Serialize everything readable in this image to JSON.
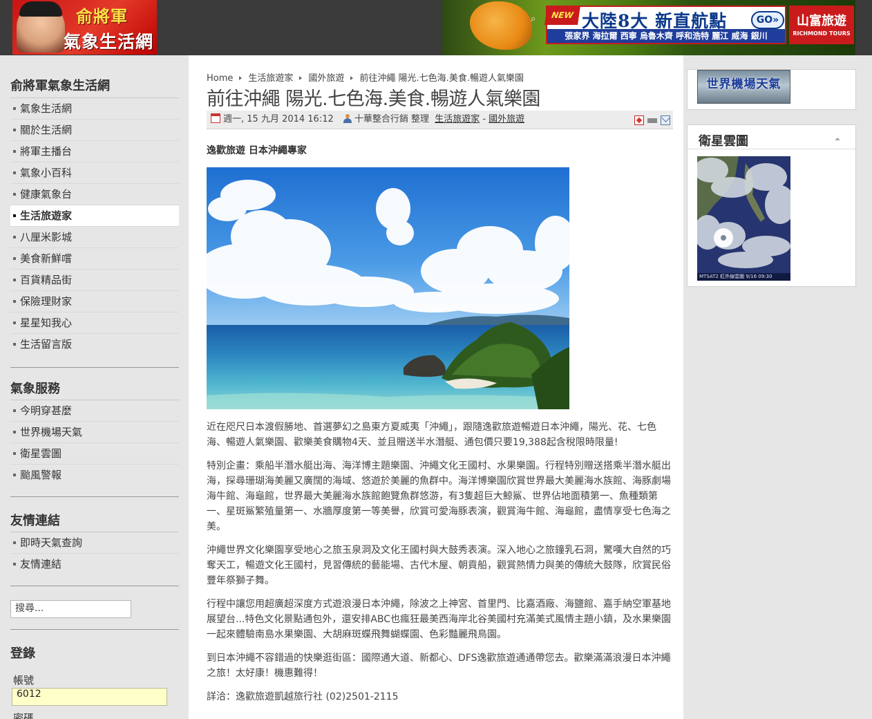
{
  "header": {
    "logo_line1": "俞將軍",
    "logo_line2": "氣象生活網",
    "ad_badge": "NEW",
    "ad_headline": "大陸8大 新直航點",
    "ad_go": "GO»",
    "ad_cities": "張家界 海拉爾 西寧 烏魯木齊 呼和浩特 麗江 威海 銀川",
    "ad_brand_zh": "山富旅遊",
    "ad_brand_en": "RICHMOND TOURS"
  },
  "sidebar": {
    "main_title": "俞將軍氣象生活網",
    "main_items": [
      "氣象生活網",
      "關於生活網",
      "將軍主播台",
      "氣象小百科",
      "健康氣象台",
      "生活旅遊家",
      "八厘米影城",
      "美食新鮮嚐",
      "百貨精品街",
      "保險理財家",
      "星星知我心",
      "生活留言版"
    ],
    "active_item": "生活旅遊家",
    "weather_title": "氣象服務",
    "weather_items": [
      "今明穿甚麼",
      "世界機場天氣",
      "衛星雲圖",
      "颱風警報"
    ],
    "links_title": "友情連結",
    "links_items": [
      "即時天氣查詢",
      "友情連結"
    ],
    "search_placeholder": "搜尋...",
    "login_title": "登錄",
    "username_label": "帳號",
    "username_value": "6012",
    "password_label": "密碼"
  },
  "breadcrumb": [
    "Home",
    "生活旅遊家",
    "國外旅遊",
    "前往沖繩 陽光.七色海.美食.暢遊人氣樂園"
  ],
  "article": {
    "title": "前往沖繩 陽光.七色海.美食.暢遊人氣樂園",
    "date": "週一, 15 九月 2014 16:12",
    "author": "十華整合行銷 整理",
    "category": "生活旅遊家",
    "category_sep": " - ",
    "subcategory": "國外旅遊",
    "subtitle": "逸歡旅遊 日本沖繩專家",
    "paragraphs": [
      "近在咫尺日本渡假勝地、首選夢幻之島東方夏威夷「沖繩」，跟隨逸歡旅遊暢遊日本沖繩，陽光、花、七色海、暢遊人氣樂園、歡樂美食購物4天、並且贈送半水潛艇、通包價只要19,388起含稅限時限量!",
      "特別企畫：乘船半潛水艇出海、海洋博主題樂園、沖繩文化王國村、水果樂園。行程特別贈送搭乘半潛水艇出海，探尋珊瑚海美麗又廣闊的海域、悠遊於美麗的魚群中。海洋博樂園欣賞世界最大美麗海水族館、海豚劇場 海牛館、海龜館，世界最大美麗海水族館飽覽魚群悠游，有3隻超巨大鯨鯊、世界佔地面積第一、魚種類第一、星斑鯊繁殖量第一、水牆厚度第一等美譽，欣賞可愛海豚表演，觀賞海牛館、海龜館，盡情享受七色海之美。",
      "沖繩世界文化樂園享受地心之旅玉泉洞及文化王國村與大鼓秀表演。深入地心之旅鐘乳石洞，驚嘆大自然的巧奪天工，暢遊文化王國村，見習傳統的藝能場、古代木屋、朝貢船，觀賞熱情力與美的傳統大鼓隊，欣賞民俗豐年祭獅子舞。",
      "行程中讓您用超廣超深度方式遊浪漫日本沖繩，除波之上神宮、首里門、比嘉酒廠、海鹽館、嘉手納空軍基地展望台...特色文化景點通包外，還安排ABC也瘋狂最美西海岸北谷美國村充滿美式風情主題小鎮，及水果樂園一起來體驗南島水果樂園、大胡麻斑蝶飛舞蝴蝶園、色彩豔麗飛鳥園。",
      "到日本沖繩不容錯過的快樂逛街區：國際通大道、新都心、DFS逸歡旅遊通通帶您去。歡樂滿滿浪漫日本沖繩之旅！太好康！機惠難得！",
      "詳洽：逸歡旅遊凱越旅行社 (02)2501-2115"
    ]
  },
  "right": {
    "airport_banner": "世界機場天氣",
    "sat_title": "衛星雲圖",
    "sat_caption": "MTSAT2 紅外線雲圖  9/16 09:30"
  }
}
